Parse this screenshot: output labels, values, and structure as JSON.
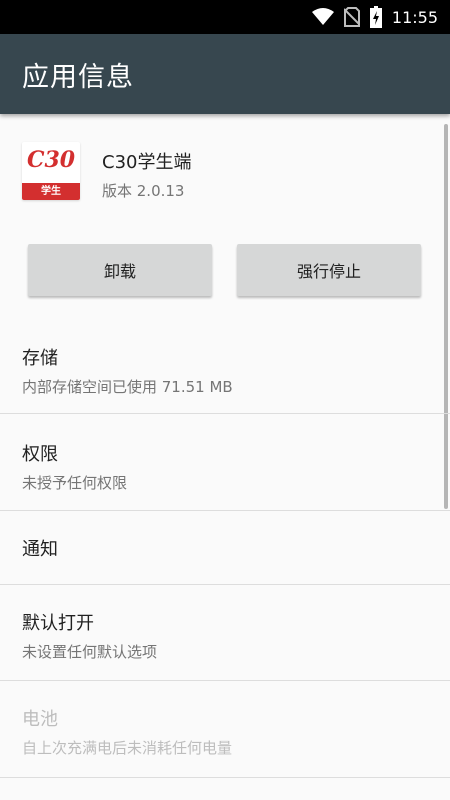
{
  "status_bar": {
    "time": "11:55",
    "icons": [
      "wifi-icon",
      "no-sim-icon",
      "battery-charging-icon"
    ]
  },
  "app_bar": {
    "title": "应用信息"
  },
  "app": {
    "icon_text": "C30",
    "icon_band_text": "学生",
    "name": "C30学生端",
    "version": "版本 2.0.13"
  },
  "buttons": {
    "uninstall": "卸载",
    "force_stop": "强行停止"
  },
  "prefs": {
    "storage": {
      "title": "存储",
      "summary": "内部存储空间已使用 71.51 MB"
    },
    "permissions": {
      "title": "权限",
      "summary": "未授予任何权限"
    },
    "notifications": {
      "title": "通知"
    },
    "open_by_default": {
      "title": "默认打开",
      "summary": "未设置任何默认选项"
    },
    "battery": {
      "title": "电池",
      "summary": "自上次充满电后未消耗任何电量"
    }
  }
}
